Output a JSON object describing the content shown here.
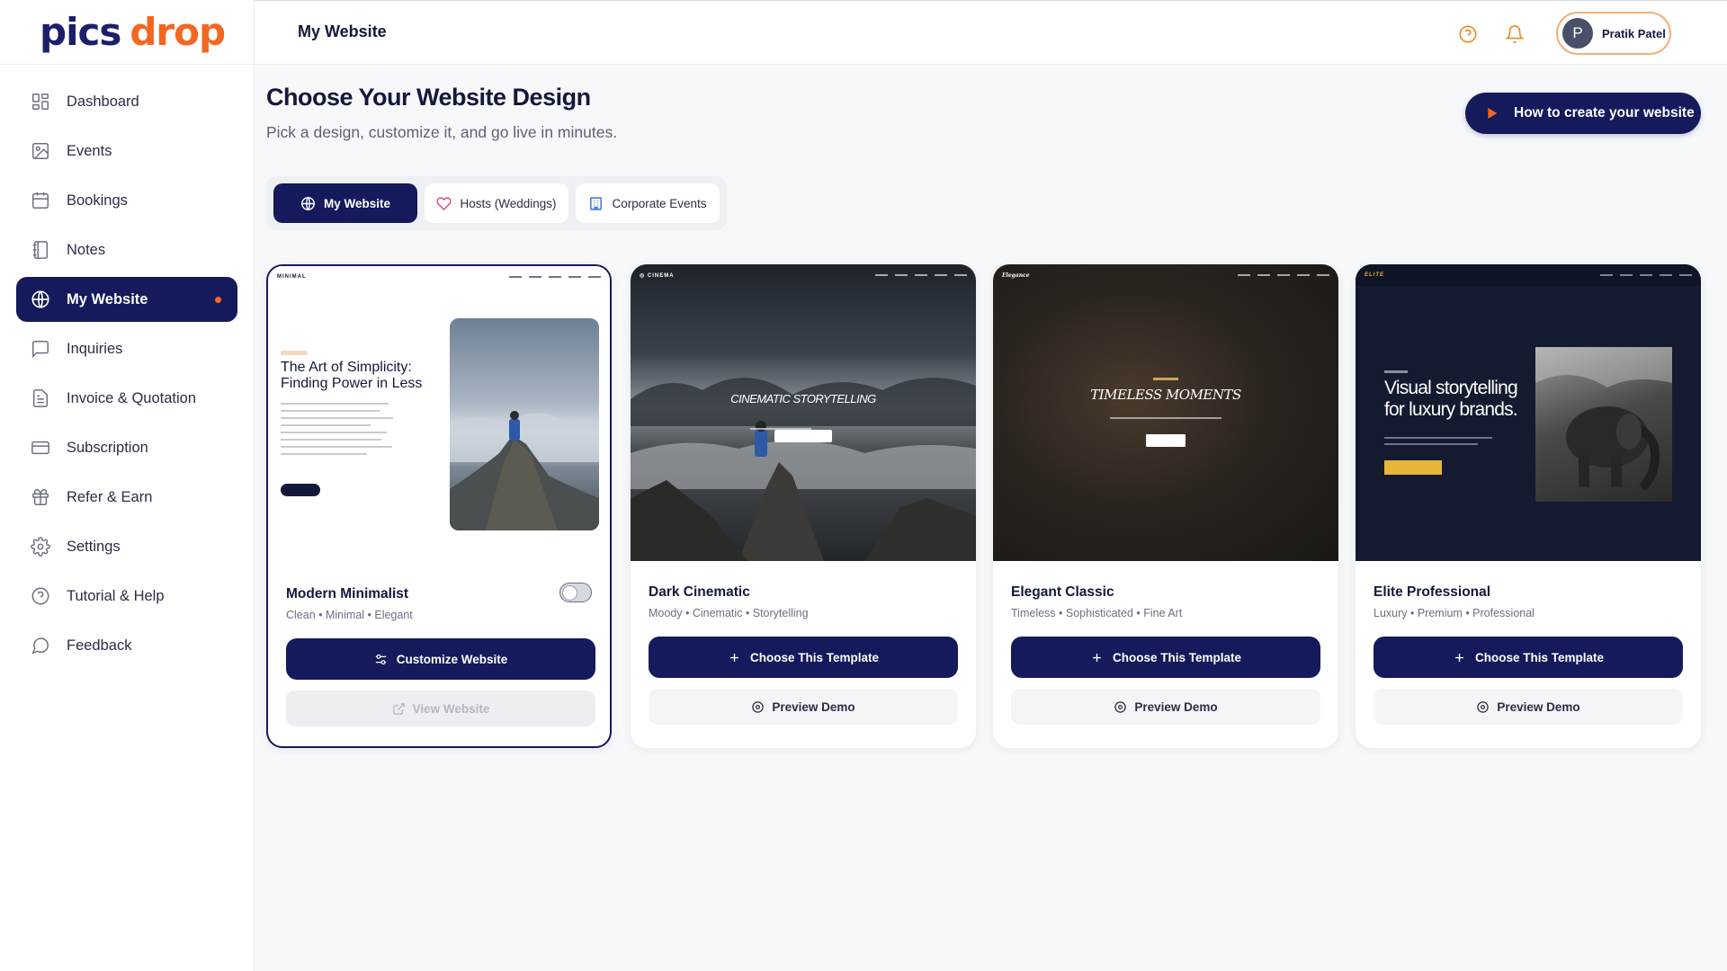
{
  "brand": {
    "part1": "pics",
    "part2": "drop"
  },
  "sidebar": {
    "items": [
      {
        "label": "Dashboard"
      },
      {
        "label": "Events"
      },
      {
        "label": "Bookings"
      },
      {
        "label": "Notes"
      },
      {
        "label": "My Website"
      },
      {
        "label": "Inquiries"
      },
      {
        "label": "Invoice & Quotation"
      },
      {
        "label": "Subscription"
      },
      {
        "label": "Refer & Earn"
      },
      {
        "label": "Settings"
      },
      {
        "label": "Tutorial & Help"
      },
      {
        "label": "Feedback"
      }
    ]
  },
  "header": {
    "title": "My Website",
    "user": {
      "initial": "P",
      "name": "Pratik Patel"
    }
  },
  "main": {
    "title": "Choose Your Website Design",
    "subtitle": "Pick a design, customize it, and go live in minutes.",
    "howto_label": "How to create your website",
    "tabs": [
      {
        "label": "My Website"
      },
      {
        "label": "Hosts (Weddings)"
      },
      {
        "label": "Corporate Events"
      }
    ]
  },
  "templates": [
    {
      "name": "Modern Minimalist",
      "tags": "Clean • Minimal • Elegant",
      "primary": "Customize Website",
      "secondary": "View Website",
      "thumb": {
        "logo": "MINIMAL",
        "headline1": "The Art of Simplicity:",
        "headline2": "Finding Power in Less"
      }
    },
    {
      "name": "Dark Cinematic",
      "tags": "Moody • Cinematic • Storytelling",
      "primary": "Choose This Template",
      "secondary": "Preview Demo",
      "thumb": {
        "logo": "◎ CINEMA",
        "headline": "CINEMATIC STORYTELLING"
      }
    },
    {
      "name": "Elegant Classic",
      "tags": "Timeless • Sophisticated • Fine Art",
      "primary": "Choose This Template",
      "secondary": "Preview Demo",
      "thumb": {
        "logo": "Elegance",
        "headline": "TIMELESS MOMENTS"
      }
    },
    {
      "name": "Elite Professional",
      "tags": "Luxury • Premium • Professional",
      "primary": "Choose This Template",
      "secondary": "Preview Demo",
      "thumb": {
        "logo": "ELITE",
        "headline1": "Visual storytelling",
        "headline2": "for luxury brands."
      }
    }
  ],
  "colors": {
    "navy": "#141a5b",
    "accent": "#f26722"
  }
}
